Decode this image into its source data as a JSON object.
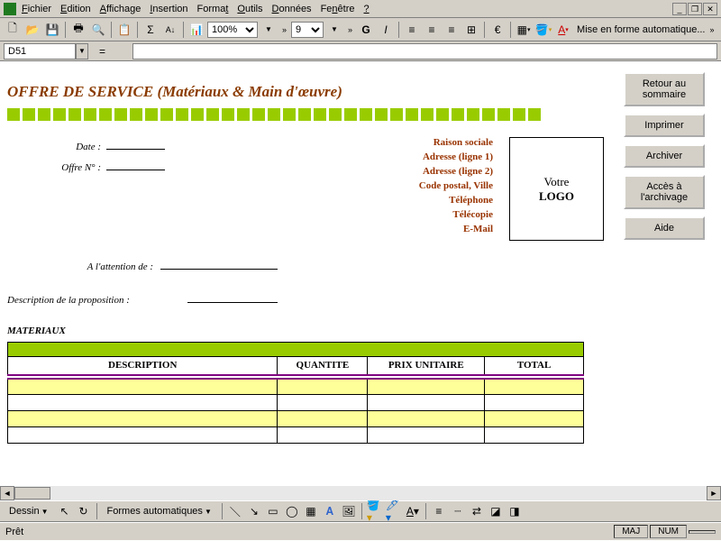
{
  "menu": {
    "file": "Fichier",
    "edit": "Edition",
    "view": "Affichage",
    "insert": "Insertion",
    "format": "Format",
    "tools": "Outils",
    "data": "Données",
    "window": "Fenêtre",
    "help": "?"
  },
  "toolbar": {
    "zoom": "100%",
    "fontsize": "9",
    "autoformat": "Mise en forme automatique..."
  },
  "namebox": "D51",
  "doc": {
    "title": "OFFRE DE SERVICE (Matériaux & Main d'œuvre)",
    "date_label": "Date :",
    "offer_label": "Offre N° :",
    "attention_label": "A l'attention de :",
    "desc_label": "Description de la proposition :",
    "company": {
      "name": "Raison sociale",
      "addr1": "Adresse (ligne 1)",
      "addr2": "Adresse (ligne 2)",
      "city": "Code postal, Ville",
      "phone": "Téléphone",
      "fax": "Télécopie",
      "email": "E-Mail"
    },
    "logo_line1": "Votre",
    "logo_line2": "LOGO",
    "section_materials": "MATERIAUX",
    "cols": {
      "desc": "DESCRIPTION",
      "qty": "QUANTITE",
      "price": "PRIX UNITAIRE",
      "total": "TOTAL"
    }
  },
  "sidebuttons": {
    "back": "Retour au sommaire",
    "print": "Imprimer",
    "archive": "Archiver",
    "access": "Accès à l'archivage",
    "help": "Aide"
  },
  "bottombar": {
    "draw": "Dessin",
    "autoshapes": "Formes automatiques"
  },
  "status": {
    "ready": "Prêt",
    "caps": "MAJ",
    "num": "NUM"
  }
}
